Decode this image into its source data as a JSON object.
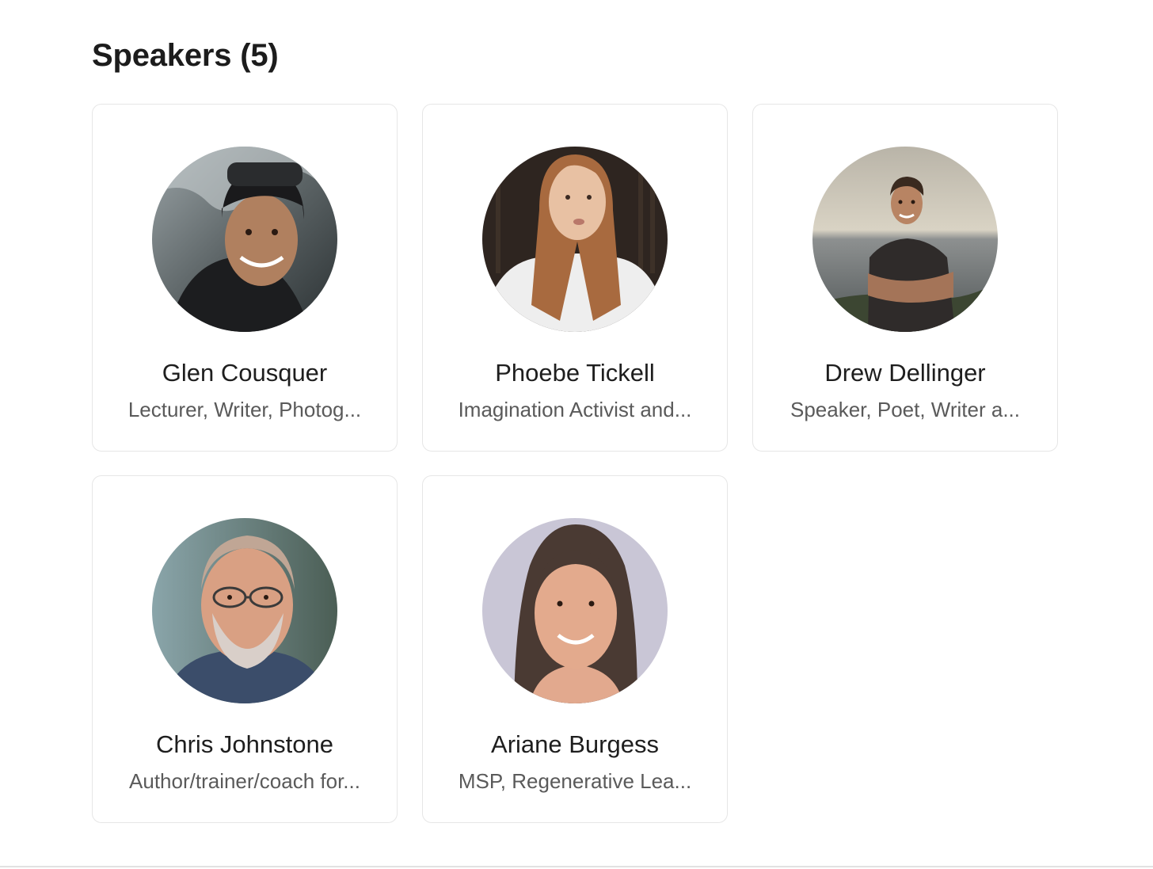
{
  "section": {
    "title": "Speakers (5)"
  },
  "speakers": [
    {
      "name": "Glen Cousquer",
      "role": "Lecturer, Writer, Photog...",
      "photo": "glen-cousquer-photo"
    },
    {
      "name": "Phoebe Tickell",
      "role": "Imagination Activist and...",
      "photo": "phoebe-tickell-photo"
    },
    {
      "name": "Drew Dellinger",
      "role": "Speaker, Poet, Writer a...",
      "photo": "drew-dellinger-photo"
    },
    {
      "name": "Chris Johnstone",
      "role": "Author/trainer/coach for...",
      "photo": "chris-johnstone-photo"
    },
    {
      "name": "Ariane Burgess",
      "role": "MSP, Regenerative Lea...",
      "photo": "ariane-burgess-photo"
    }
  ]
}
